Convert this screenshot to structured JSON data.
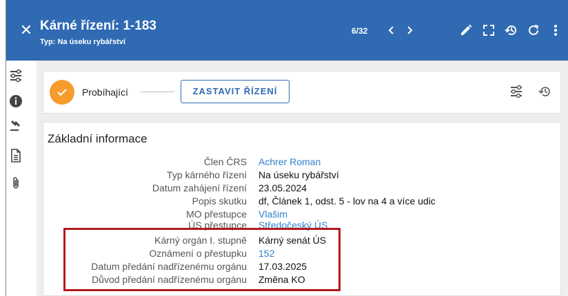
{
  "header": {
    "title": "Kárné řízení: 1-183",
    "subtitle": "Typ: Na úseku rybářství",
    "pager": "6/32",
    "background": "#2f6ab2"
  },
  "status": {
    "state": "Probíhající",
    "action_button": "ZASTAVIT ŘÍZENÍ",
    "state_color": "#f59c2c"
  },
  "section": {
    "title": "Základní informace"
  },
  "rows": [
    {
      "label": "Člen ČRS",
      "value": "Achrer Roman",
      "link": true
    },
    {
      "label": "Typ kárného řízení",
      "value": "Na úseku rybářství",
      "link": false
    },
    {
      "label": "Datum zahájení řízení",
      "value": "23.05.2024",
      "link": false
    },
    {
      "label": "Popis skutku",
      "value": "df, Článek 1, odst. 5 - lov na 4 a více udic",
      "link": false
    },
    {
      "label": "MO přestupce",
      "value": "Vlašim",
      "link": true
    },
    {
      "label": "ÚS přestupce",
      "value": "Středočeský ÚS",
      "link": true
    },
    {
      "label": "Kárný orgán I. stupně",
      "value": "Kárný senát ÚS",
      "link": false
    },
    {
      "label": "Oznámení o přestupku",
      "value": "152",
      "link": true
    },
    {
      "label": "Datum předání nadřízenému orgánu",
      "value": "17.03.2025",
      "link": false
    },
    {
      "label": "Důvod předání nadřízenému orgánu",
      "value": "Změna KO",
      "link": false
    }
  ],
  "icons": {
    "close": "close-icon",
    "prev": "chevron-left-icon",
    "next": "chevron-right-icon",
    "edit": "pencil-icon",
    "fullscreen": "fullscreen-icon",
    "history": "history-icon",
    "refresh": "refresh-icon",
    "more": "more-vert-icon"
  },
  "highlight_color": "#b3191b"
}
